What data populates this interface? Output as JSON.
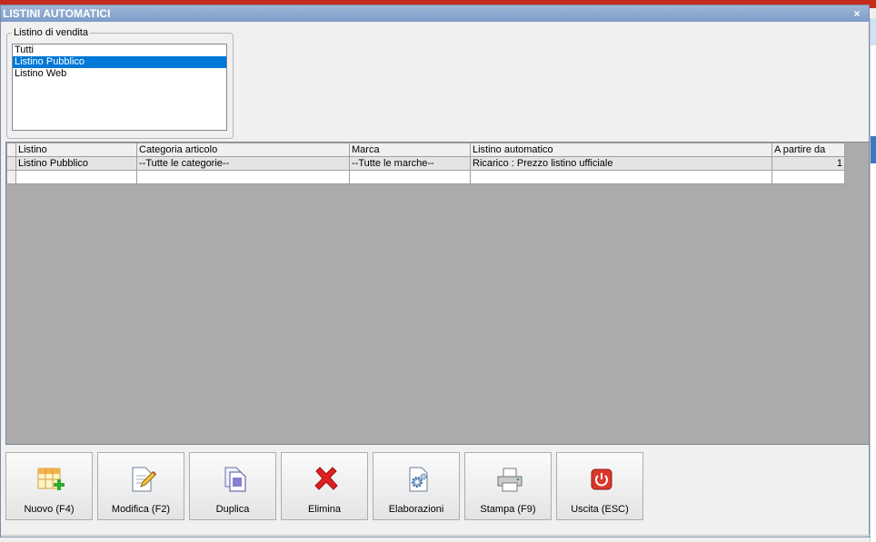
{
  "window": {
    "title": "LISTINI AUTOMATICI",
    "close_glyph": "×"
  },
  "listino_group": {
    "label": "Listino di vendita",
    "items": [
      "Tutti",
      "Listino Pubblico",
      "Listino Web"
    ],
    "selected": "Listino Pubblico"
  },
  "grid": {
    "columns": [
      "Listino",
      "Categoria articolo",
      "Marca",
      "Listino automatico",
      "A partire da"
    ],
    "rows": [
      [
        "Listino Pubblico",
        "--Tutte le categorie--",
        "--Tutte le marche--",
        "Ricarico : Prezzo listino ufficiale",
        "1"
      ]
    ]
  },
  "toolbar": {
    "nuovo": "Nuovo (F4)",
    "modifica": "Modifica (F2)",
    "duplica": "Duplica",
    "elimina": "Elimina",
    "elaborazioni": "Elaborazioni",
    "stampa": "Stampa (F9)",
    "uscita": "Uscita (ESC)"
  },
  "colors": {
    "titlebar": "#7d9cc7",
    "selection": "#0078d7",
    "grid_bg": "#ababab",
    "delete_red": "#e02020",
    "exit_red": "#d9382a"
  },
  "icons": [
    "table-add-icon",
    "edit-document-icon",
    "duplicate-icon",
    "delete-x-icon",
    "process-gear-icon",
    "printer-icon",
    "power-icon"
  ]
}
